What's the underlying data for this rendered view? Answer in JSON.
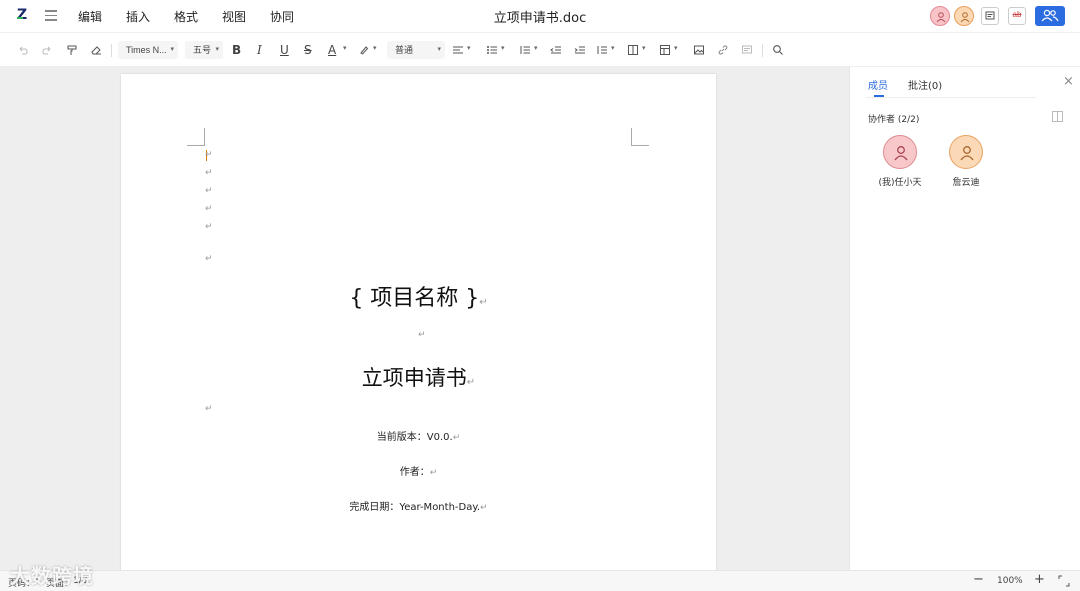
{
  "app": {
    "logo_letter": "Z",
    "menu": [
      "编辑",
      "插入",
      "格式",
      "视图",
      "协同"
    ],
    "doc_title": "立项申请书.doc",
    "comment_btn_label": "ab"
  },
  "toolbar": {
    "font_family": "Times N...",
    "font_size": "五号",
    "bold": "B",
    "italic": "I",
    "underline": "U",
    "strikethrough": "S",
    "font_color": "A",
    "paragraph_style": "普通"
  },
  "document": {
    "project_name": "{  项目名称  }",
    "title": "立项申请书",
    "version_line": "当前版本：V0.0.",
    "author_line": "作者：",
    "date_line": "完成日期：Year-Month-Day."
  },
  "side_panel": {
    "tabs": [
      "成员",
      "批注(0)"
    ],
    "active_tab": "成员",
    "collaborators_label": "协作者 (2/2)",
    "members": [
      {
        "name": "(我)任小天",
        "color": "#f7c7ca"
      },
      {
        "name": "詹云迪",
        "color": "#fbd8b6"
      }
    ]
  },
  "status": {
    "page_label": "页码：",
    "page_value": "1",
    "pages_label": "页面：",
    "pages_value": "1/8",
    "zoom": "100%"
  },
  "watermark": "大数跨境",
  "colors": {
    "accent": "#2b6de0",
    "workspace_bg": "#eeeeee"
  }
}
